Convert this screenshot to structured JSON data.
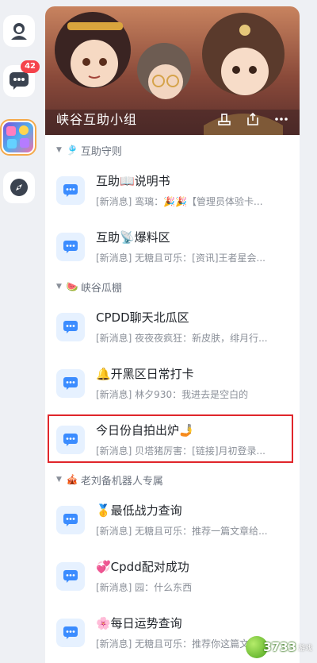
{
  "rail": {
    "messages_badge": "42"
  },
  "banner": {
    "title": "峡谷互助小组"
  },
  "groups": [
    {
      "emoji": "🎐",
      "title": "互助守则",
      "channels": [
        {
          "name": "互助📖说明书",
          "preview": "[新消息] 鸾璃：🎉🎉【管理员体验卡..."
        },
        {
          "name": "互助📡爆料区",
          "preview": "[新消息] 无糖且可乐：[资讯]王者星会..."
        }
      ]
    },
    {
      "emoji": "🍉",
      "title": "峡谷瓜棚",
      "channels": [
        {
          "name": "CPDD聊天北瓜区",
          "preview": "[新消息] 夜夜夜疯狂：新皮肤，绯月行..."
        },
        {
          "name": "🔔开黑区日常打卡",
          "preview": "[新消息] 林夕930：我进去是空白的"
        },
        {
          "name": "今日份自拍出炉🤳",
          "preview": "[新消息] 贝塔猪厉害：[链接]月初登录..."
        }
      ]
    },
    {
      "emoji": "🎪",
      "title": "老刘备机器人专属",
      "channels": [
        {
          "name": "🥇最低战力查询",
          "preview": "[新消息] 无糖且可乐：推荐一篇文章给..."
        },
        {
          "name": "💞Cpdd配对成功",
          "preview": "[新消息] 园：什么东西"
        },
        {
          "name": "🌸每日运势查询",
          "preview": "[新消息] 无糖且可乐：推荐你这篇文章"
        }
      ]
    }
  ],
  "watermark": {
    "text": "3733",
    "sub": "游戏"
  }
}
